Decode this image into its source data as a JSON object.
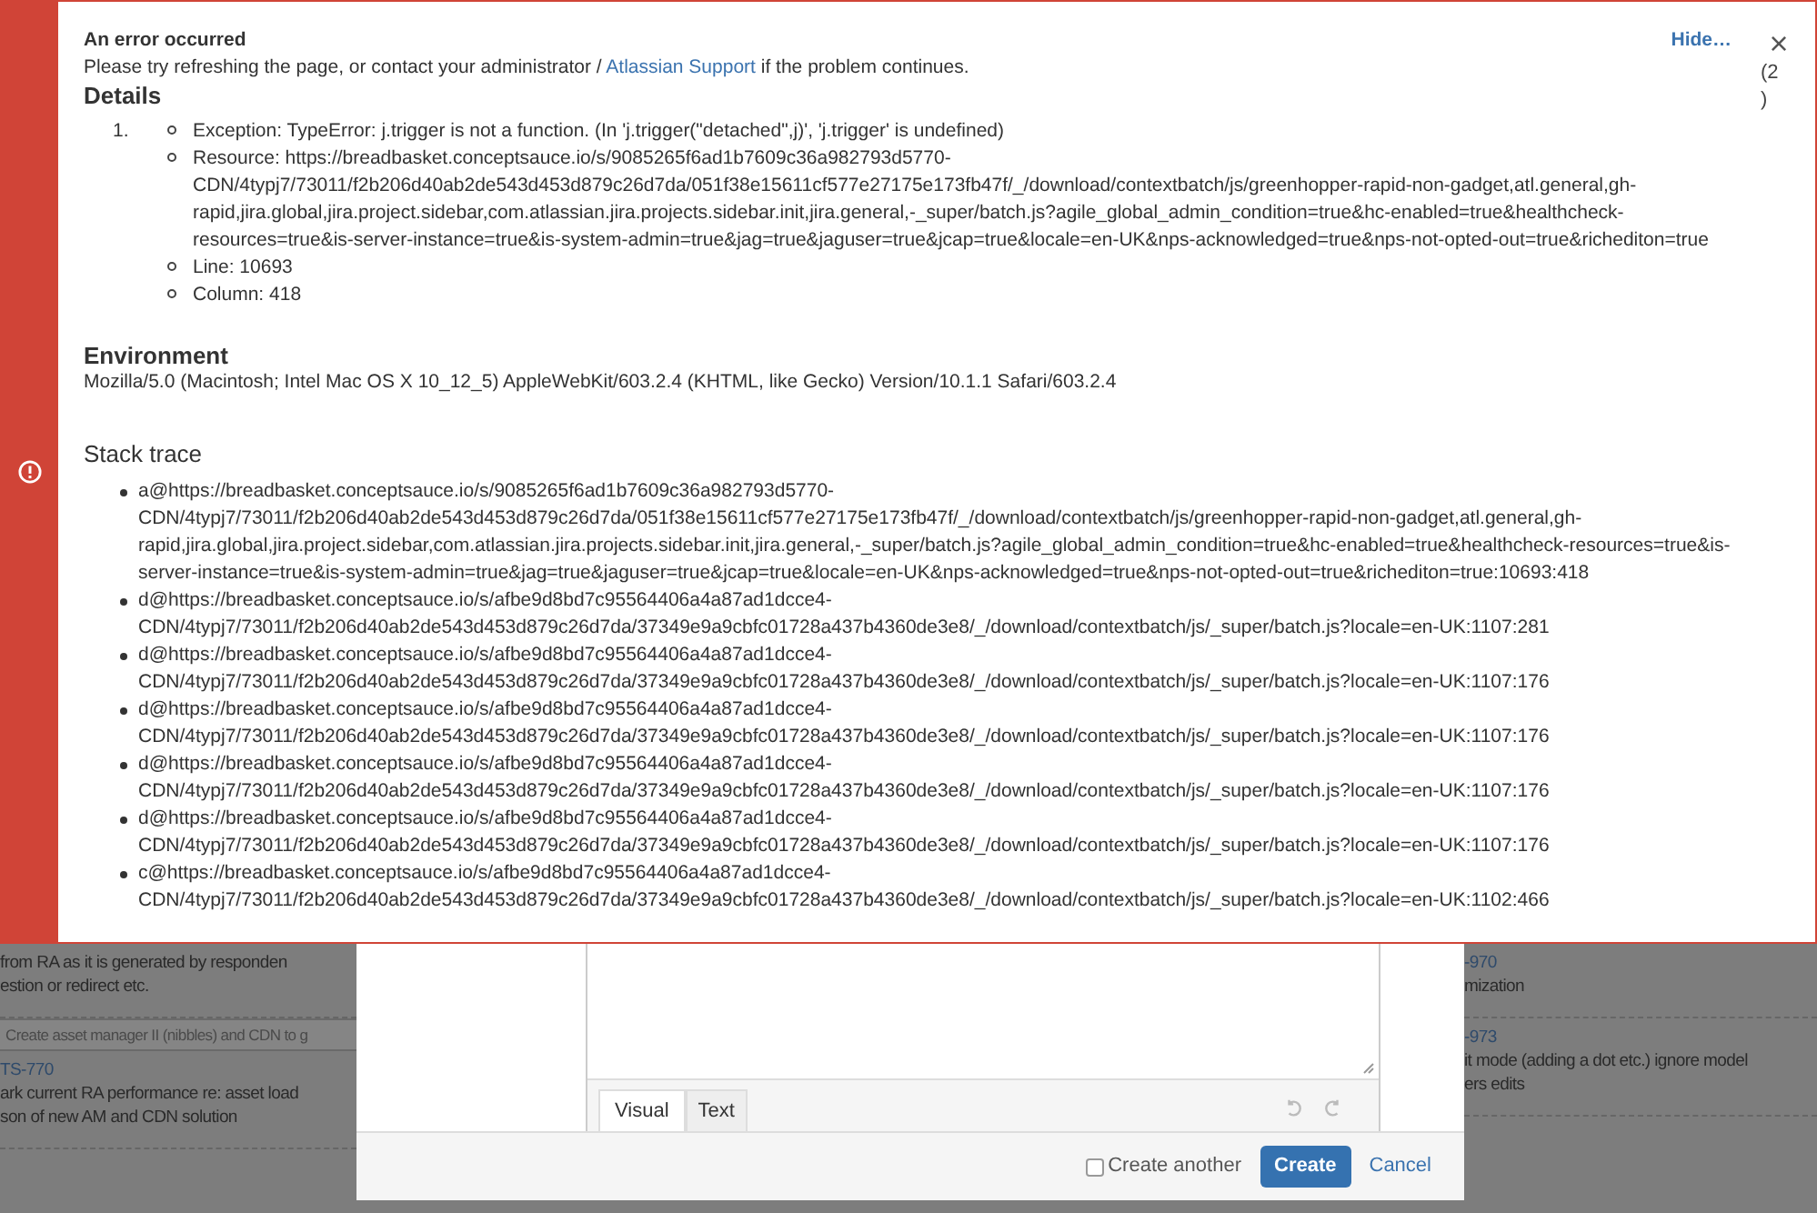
{
  "error": {
    "title": "An error occurred",
    "message_before": "Please try refreshing the page, or contact your administrator / ",
    "link": "Atlassian Support",
    "message_after": " if the problem continues.",
    "hide": "Hide…",
    "close": "×",
    "count": "(2\n)",
    "details_heading": "Details",
    "details": [
      {
        "number": "1.",
        "items": [
          "Exception: TypeError: j.trigger is not a function. (In 'j.trigger(\"detached\",j)', 'j.trigger' is undefined)",
          "Resource: https://breadbasket.conceptsauce.io/s/9085265f6ad1b7609c36a982793d5770-CDN/4typj7/73011/f2b206d40ab2de543d453d879c26d7da/051f38e15611cf577e27175e173fb47f/_/download/contextbatch/js/greenhopper-rapid-non-gadget,atl.general,gh-rapid,jira.global,jira.project.sidebar,com.atlassian.jira.projects.sidebar.init,jira.general,-_super/batch.js?agile_global_admin_condition=true&hc-enabled=true&healthcheck-resources=true&is-server-instance=true&is-system-admin=true&jag=true&jaguser=true&jcap=true&locale=en-UK&nps-acknowledged=true&nps-not-opted-out=true&richediton=true",
          "Line: 10693",
          "Column: 418"
        ]
      }
    ],
    "environment_heading": "Environment",
    "environment": "Mozilla/5.0 (Macintosh; Intel Mac OS X 10_12_5) AppleWebKit/603.2.4 (KHTML, like Gecko) Version/10.1.1 Safari/603.2.4",
    "stack_heading": "Stack trace",
    "stack": [
      "a@https://breadbasket.conceptsauce.io/s/9085265f6ad1b7609c36a982793d5770-CDN/4typj7/73011/f2b206d40ab2de543d453d879c26d7da/051f38e15611cf577e27175e173fb47f/_/download/contextbatch/js/greenhopper-rapid-non-gadget,atl.general,gh-rapid,jira.global,jira.project.sidebar,com.atlassian.jira.projects.sidebar.init,jira.general,-_super/batch.js?agile_global_admin_condition=true&hc-enabled=true&healthcheck-resources=true&is-server-instance=true&is-system-admin=true&jag=true&jaguser=true&jcap=true&locale=en-UK&nps-acknowledged=true&nps-not-opted-out=true&richediton=true:10693:418",
      "d@https://breadbasket.conceptsauce.io/s/afbe9d8bd7c95564406a4a87ad1dcce4-CDN/4typj7/73011/f2b206d40ab2de543d453d879c26d7da/37349e9a9cbfc01728a437b4360de3e8/_/download/contextbatch/js/_super/batch.js?locale=en-UK:1107:281",
      "d@https://breadbasket.conceptsauce.io/s/afbe9d8bd7c95564406a4a87ad1dcce4-CDN/4typj7/73011/f2b206d40ab2de543d453d879c26d7da/37349e9a9cbfc01728a437b4360de3e8/_/download/contextbatch/js/_super/batch.js?locale=en-UK:1107:176",
      "d@https://breadbasket.conceptsauce.io/s/afbe9d8bd7c95564406a4a87ad1dcce4-CDN/4typj7/73011/f2b206d40ab2de543d453d879c26d7da/37349e9a9cbfc01728a437b4360de3e8/_/download/contextbatch/js/_super/batch.js?locale=en-UK:1107:176",
      "d@https://breadbasket.conceptsauce.io/s/afbe9d8bd7c95564406a4a87ad1dcce4-CDN/4typj7/73011/f2b206d40ab2de543d453d879c26d7da/37349e9a9cbfc01728a437b4360de3e8/_/download/contextbatch/js/_super/batch.js?locale=en-UK:1107:176",
      "d@https://breadbasket.conceptsauce.io/s/afbe9d8bd7c95564406a4a87ad1dcce4-CDN/4typj7/73011/f2b206d40ab2de543d453d879c26d7da/37349e9a9cbfc01728a437b4360de3e8/_/download/contextbatch/js/_super/batch.js?locale=en-UK:1107:176",
      "c@https://breadbasket.conceptsauce.io/s/afbe9d8bd7c95564406a4a87ad1dcce4-CDN/4typj7/73011/f2b206d40ab2de543d453d879c26d7da/37349e9a9cbfc01728a437b4360de3e8/_/download/contextbatch/js/_super/batch.js?locale=en-UK:1102:466"
    ]
  },
  "board_left": [
    {
      "kind": "card",
      "lines": [
        "from RA as it is generated by responden",
        "estion or redirect etc."
      ]
    },
    {
      "kind": "bar",
      "text": "Create asset manager II (nibbles) and CDN to g"
    },
    {
      "kind": "card",
      "key": "TS-770",
      "lines": [
        "ark current RA performance re: asset load",
        "son of new AM and CDN solution"
      ]
    }
  ],
  "board_right": [
    {
      "kind": "card",
      "key": "-970",
      "lines": [
        "mization"
      ]
    },
    {
      "kind": "card",
      "key": "-973",
      "lines": [
        "it mode (adding a dot etc.) ignore model",
        "ers edits"
      ]
    }
  ],
  "dialog": {
    "editor_tabs": [
      {
        "label": "Visual",
        "selected": true
      },
      {
        "label": "Text",
        "selected": false
      }
    ],
    "create_another": {
      "label": "Create another",
      "checked": false
    },
    "create": "Create",
    "cancel": "Cancel"
  }
}
